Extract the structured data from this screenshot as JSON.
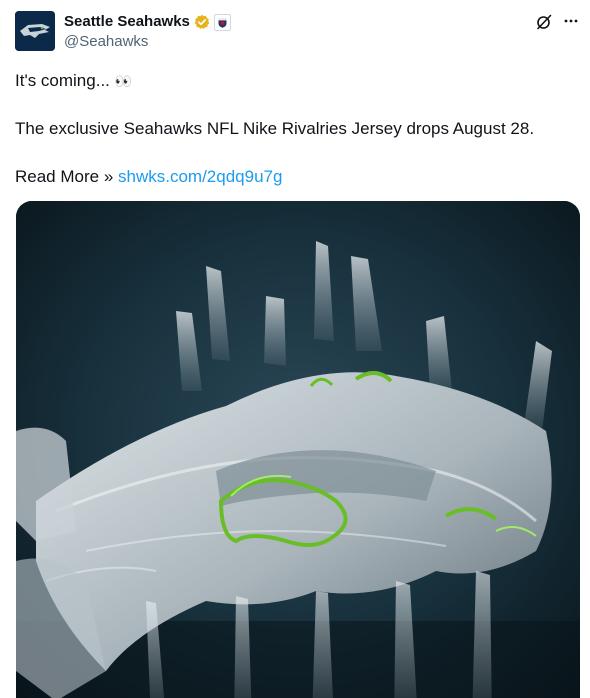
{
  "account": {
    "display_name": "Seattle Seahawks",
    "handle": "@Seahawks",
    "verified_badge_color": "#e6b31e"
  },
  "icons": {
    "verified": "verified-badge-icon",
    "affiliate": "nfl-affiliate-icon",
    "grok": "grok-icon",
    "more": "more-icon"
  },
  "tweet": {
    "line1": "It's coming...",
    "line1_emoji": "👀",
    "line2": "The exclusive Seahawks NFL Nike Rivalries Jersey drops August 28.",
    "line3_prefix": "Read More »",
    "link_text": "shwks.com/2qdq9u7g"
  },
  "colors": {
    "link": "#1d9bf0",
    "text": "#0f1419",
    "secondary": "#536471",
    "accent_green": "#69be28"
  }
}
